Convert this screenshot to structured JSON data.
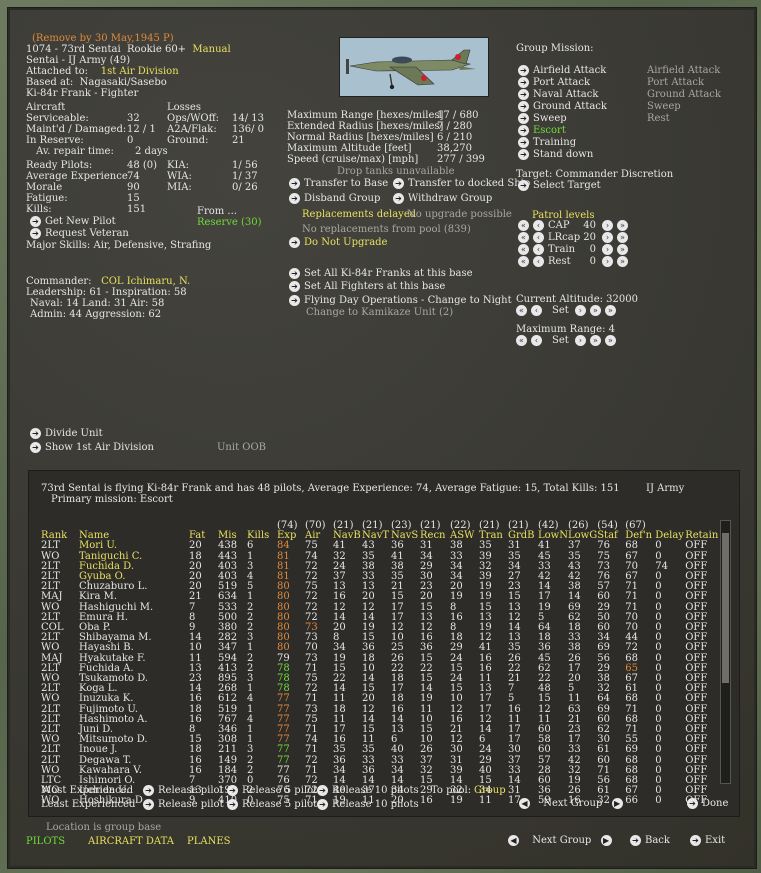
{
  "header": {
    "remove_note": "(Remove by 30 May,1945 P)",
    "unit_line": "1074 - 73rd Sentai",
    "rookie": "Rookie 60+",
    "manual": "Manual",
    "sentai_line": "Sentai - IJ Army (49)",
    "attached_label": "Attached to:",
    "attached_value": "1st Air Division",
    "based_label": "Based at:",
    "based_value": "Nagasaki/Sasebo",
    "aircraft_type": "Ki-84r Frank - Fighter"
  },
  "aircraft": {
    "title": "Aircraft",
    "serviceable_label": "Serviceable:",
    "serviceable": "32",
    "maint_label": "Maint'd / Damaged:",
    "maint": "12 / 1",
    "reserve_label": "In Reserve:",
    "reserve": "0",
    "repair_label": "Av. repair time:",
    "repair": "2 days"
  },
  "losses": {
    "title": "Losses",
    "ops_label": "Ops/WOff:",
    "ops": "14/ 13",
    "a2a_label": "A2A/Flak:",
    "a2a": "136/ 0",
    "ground_label": "Ground:",
    "ground": "21"
  },
  "pilots": {
    "ready_label": "Ready Pilots:",
    "ready": "48 (0)",
    "avgexp_label": "Average Experience",
    "avgexp": "74",
    "morale_label": "Morale",
    "morale": "90",
    "fatigue_label": "Fatigue:",
    "fatigue": "15",
    "kills_label": "Kills:",
    "kills": "151",
    "kia_label": "KIA:",
    "kia": "1/ 56",
    "wia_label": "WIA:",
    "wia": "1/ 37",
    "mia_label": "MIA:",
    "mia": "0/ 26",
    "from_label": "From ...",
    "from_value": "Reserve (30)",
    "get_new_pilot": "Get New Pilot",
    "request_veteran": "Request Veteran",
    "major_skills": "Major Skills:  Air, Defensive, Strafing"
  },
  "commander": {
    "label": "Commander:",
    "name": "COL Ichimaru, N.",
    "leadership": "Leadership: 61 - Inspiration: 58",
    "naval": "Naval: 14  Land: 31  Air: 58",
    "admin": "Admin: 44  Aggression: 62"
  },
  "specs": {
    "max_range_label": "Maximum Range [hexes/miles]",
    "max_range": "17 / 680",
    "ext_radius_label": "Extended Radius [hexes/miles]",
    "ext_radius": "7 / 280",
    "norm_radius_label": "Normal Radius [hexes/miles]",
    "norm_radius": "6 / 210",
    "max_alt_label": "Maximum Altitude [feet]",
    "max_alt": "38,270",
    "speed_label": "Speed (cruise/max) [mph]",
    "speed": "277 / 399",
    "drop_tanks": "Drop tanks unavailable"
  },
  "actions": {
    "transfer_base": "Transfer to Base",
    "transfer_ship": "Transfer to docked Ship",
    "disband": "Disband Group",
    "withdraw": "Withdraw Group",
    "replacements_delayed": "Replacements delayed",
    "no_upgrade": "No upgrade possible",
    "no_replacements": "No replacements from pool (839)",
    "do_not_upgrade": "Do Not Upgrade",
    "set_all_franks": "Set All Ki-84r Franks at this base",
    "set_all_fighters": "Set All Fighters at this base",
    "flying_day": "Flying Day Operations - Change to Night",
    "kamikaze": "Change to Kamikaze Unit (2)"
  },
  "mission": {
    "title": "Group Mission:",
    "items": [
      "Airfield Attack",
      "Port Attack",
      "Naval Attack",
      "Ground Attack",
      "Sweep",
      "Escort",
      "Training",
      "Stand down"
    ],
    "secondary": [
      "Airfield Attack",
      "Port Attack",
      "Ground Attack",
      "Sweep",
      "Rest"
    ],
    "target_label": "Target: Commander Discretion",
    "select_target": "Select Target",
    "patrol_title": "Patrol levels",
    "patrol": [
      {
        "label": "CAP",
        "value": "40"
      },
      {
        "label": "LRcap",
        "value": "20"
      },
      {
        "label": "Train",
        "value": "0"
      },
      {
        "label": "Rest",
        "value": "0"
      }
    ],
    "altitude": "Current Altitude: 32000",
    "set": "Set",
    "max_range": "Maximum Range: 4"
  },
  "divide_unit": "Divide Unit",
  "show_division": "Show 1st Air Division",
  "unit_oob": "Unit OOB",
  "roster": {
    "summary": "73rd Sentai is flying Ki-84r Frank and has 48 pilots,  Average Experience: 74,  Average Fatigue: 15,  Total Kills: 151",
    "branch": "IJ Army",
    "primary": "Primary mission: Escort",
    "averages": [
      "",
      "",
      "",
      "",
      "",
      "(74)",
      "(70)",
      "(21)",
      "(21)",
      "(23)",
      "(21)",
      "(22)",
      "(21)",
      "(21)",
      "(42)",
      "(26)",
      "(54)",
      "(67)",
      "",
      ""
    ],
    "columns": [
      "Rank",
      "Name",
      "Fat",
      "Mis",
      "Kills",
      "Exp",
      "Air",
      "NavB",
      "NavT",
      "NavS",
      "Recn",
      "ASW",
      "Tran",
      "GrdB",
      "LowN",
      "LowG",
      "Staf",
      "Def'n",
      "Delay",
      "Retain"
    ],
    "rows": [
      [
        "2LT",
        "Mori U.",
        "20",
        "438",
        "6",
        "84",
        "75",
        "41",
        "43",
        "36",
        "31",
        "38",
        "35",
        "31",
        "41",
        "37",
        "76",
        "68",
        "0",
        "OFF"
      ],
      [
        "WO",
        "Taniguchi C.",
        "18",
        "443",
        "1",
        "81",
        "74",
        "32",
        "35",
        "41",
        "34",
        "33",
        "39",
        "35",
        "45",
        "35",
        "75",
        "67",
        "0",
        "OFF"
      ],
      [
        "2LT",
        "Fuchida D.",
        "20",
        "403",
        "3",
        "81",
        "72",
        "24",
        "38",
        "38",
        "29",
        "34",
        "32",
        "34",
        "33",
        "43",
        "73",
        "70",
        "74",
        "OFF"
      ],
      [
        "2LT",
        "Gyuba O.",
        "20",
        "403",
        "4",
        "81",
        "72",
        "37",
        "33",
        "35",
        "30",
        "34",
        "39",
        "27",
        "42",
        "42",
        "76",
        "67",
        "0",
        "OFF"
      ],
      [
        "2LT",
        "Chuzaburo L.",
        "20",
        "519",
        "5",
        "80",
        "75",
        "13",
        "13",
        "21",
        "23",
        "20",
        "19",
        "23",
        "14",
        "38",
        "57",
        "71",
        "0",
        "OFF"
      ],
      [
        "MAJ",
        "Kira M.",
        "21",
        "634",
        "1",
        "80",
        "72",
        "16",
        "20",
        "15",
        "20",
        "19",
        "19",
        "15",
        "17",
        "14",
        "60",
        "71",
        "0",
        "OFF"
      ],
      [
        "WO",
        "Hashiguchi M.",
        "7",
        "533",
        "2",
        "80",
        "72",
        "12",
        "12",
        "17",
        "15",
        "8",
        "15",
        "13",
        "19",
        "69",
        "29",
        "71",
        "0",
        "OFF"
      ],
      [
        "2LT",
        "Emura H.",
        "8",
        "500",
        "2",
        "80",
        "72",
        "14",
        "14",
        "17",
        "13",
        "16",
        "13",
        "12",
        "5",
        "62",
        "50",
        "70",
        "0",
        "OFF"
      ],
      [
        "COL",
        "Oba P.",
        "9",
        "380",
        "2",
        "80",
        "73",
        "20",
        "19",
        "12",
        "12",
        "8",
        "19",
        "14",
        "64",
        "18",
        "60",
        "70",
        "0",
        "OFF"
      ],
      [
        "2LT",
        "Shibayama M.",
        "14",
        "282",
        "3",
        "80",
        "73",
        "8",
        "15",
        "10",
        "16",
        "18",
        "12",
        "13",
        "18",
        "33",
        "34",
        "44",
        "0",
        "OFF"
      ],
      [
        "WO",
        "Hayashi B.",
        "10",
        "347",
        "1",
        "80",
        "70",
        "34",
        "36",
        "25",
        "36",
        "29",
        "41",
        "35",
        "36",
        "38",
        "69",
        "72",
        "0",
        "OFF"
      ],
      [
        "MAJ",
        "Hyakutake F.",
        "11",
        "594",
        "2",
        "79",
        "73",
        "19",
        "18",
        "26",
        "15",
        "24",
        "16",
        "26",
        "45",
        "26",
        "56",
        "68",
        "0",
        "OFF"
      ],
      [
        "2LT",
        "Fuchida A.",
        "13",
        "413",
        "2",
        "78",
        "71",
        "15",
        "10",
        "22",
        "22",
        "15",
        "16",
        "22",
        "62",
        "17",
        "29",
        "65",
        "0",
        "OFF"
      ],
      [
        "WO",
        "Tsukamoto D.",
        "23",
        "895",
        "3",
        "78",
        "75",
        "22",
        "14",
        "18",
        "15",
        "24",
        "11",
        "21",
        "22",
        "20",
        "38",
        "67",
        "0",
        "OFF"
      ],
      [
        "2LT",
        "Koga L.",
        "14",
        "268",
        "1",
        "78",
        "72",
        "14",
        "15",
        "17",
        "14",
        "15",
        "13",
        "7",
        "48",
        "5",
        "32",
        "61",
        "0",
        "OFF"
      ],
      [
        "WO",
        "Inuzuka K.",
        "16",
        "612",
        "4",
        "77",
        "71",
        "11",
        "20",
        "18",
        "19",
        "10",
        "17",
        "5",
        "15",
        "11",
        "64",
        "68",
        "0",
        "OFF"
      ],
      [
        "2LT",
        "Fujimoto U.",
        "18",
        "519",
        "1",
        "77",
        "73",
        "18",
        "12",
        "16",
        "11",
        "12",
        "17",
        "16",
        "12",
        "63",
        "69",
        "71",
        "0",
        "OFF"
      ],
      [
        "2LT",
        "Hashimoto A.",
        "16",
        "767",
        "4",
        "77",
        "75",
        "11",
        "14",
        "14",
        "10",
        "16",
        "12",
        "11",
        "11",
        "21",
        "60",
        "68",
        "0",
        "OFF"
      ],
      [
        "2LT",
        "Juni D.",
        "8",
        "346",
        "1",
        "77",
        "71",
        "17",
        "15",
        "13",
        "15",
        "21",
        "14",
        "17",
        "60",
        "23",
        "62",
        "71",
        "0",
        "OFF"
      ],
      [
        "WO",
        "Mitsumoto D.",
        "15",
        "308",
        "1",
        "77",
        "74",
        "16",
        "11",
        "6",
        "10",
        "12",
        "6",
        "17",
        "58",
        "17",
        "30",
        "55",
        "0",
        "OFF"
      ],
      [
        "2LT",
        "Inoue J.",
        "18",
        "211",
        "3",
        "77",
        "71",
        "35",
        "35",
        "40",
        "26",
        "30",
        "24",
        "30",
        "60",
        "33",
        "61",
        "69",
        "0",
        "OFF"
      ],
      [
        "2LT",
        "Degawa T.",
        "16",
        "149",
        "2",
        "77",
        "72",
        "36",
        "33",
        "33",
        "37",
        "31",
        "29",
        "37",
        "57",
        "42",
        "60",
        "68",
        "0",
        "OFF"
      ],
      [
        "WO",
        "Kawahara V.",
        "16",
        "184",
        "2",
        "77",
        "71",
        "34",
        "36",
        "34",
        "32",
        "39",
        "40",
        "33",
        "28",
        "32",
        "71",
        "68",
        "0",
        "OFF"
      ],
      [
        "LTC",
        "Ishimori O.",
        "7",
        "370",
        "0",
        "76",
        "72",
        "14",
        "14",
        "14",
        "15",
        "14",
        "15",
        "14",
        "60",
        "19",
        "56",
        "68",
        "0",
        "OFF"
      ],
      [
        "WO",
        "Uchida U.",
        "13",
        "193",
        "2",
        "76",
        "72",
        "40",
        "37",
        "34",
        "29",
        "32",
        "34",
        "31",
        "36",
        "26",
        "61",
        "67",
        "0",
        "OFF"
      ],
      [
        "WO",
        "Hoshikura D.",
        "9",
        "410",
        "0",
        "75",
        "71",
        "19",
        "11",
        "20",
        "16",
        "19",
        "11",
        "17",
        "59",
        "16",
        "32",
        "66",
        "0",
        "OFF"
      ]
    ],
    "most_experienced": "Most Experienced",
    "least_experienced": "Least Experienced",
    "release_pilot": "Release pilot",
    "release_5": "Release 5 pilots",
    "release_10": "Release 10 pilots",
    "to_pool": "To pool:",
    "to_pool_value": "Group",
    "next_group": "Next Group",
    "done": "Done"
  },
  "footer": {
    "location": "Location is group base",
    "tab_pilots": "PILOTS",
    "tab_aircraft": "AIRCRAFT DATA",
    "tab_planes": "PLANES",
    "next_group": "Next Group",
    "back": "Back",
    "exit": "Exit"
  },
  "colors": {
    "yellow": "#e8e060",
    "green": "#6fdc3a",
    "orange": "#e08a3c"
  }
}
